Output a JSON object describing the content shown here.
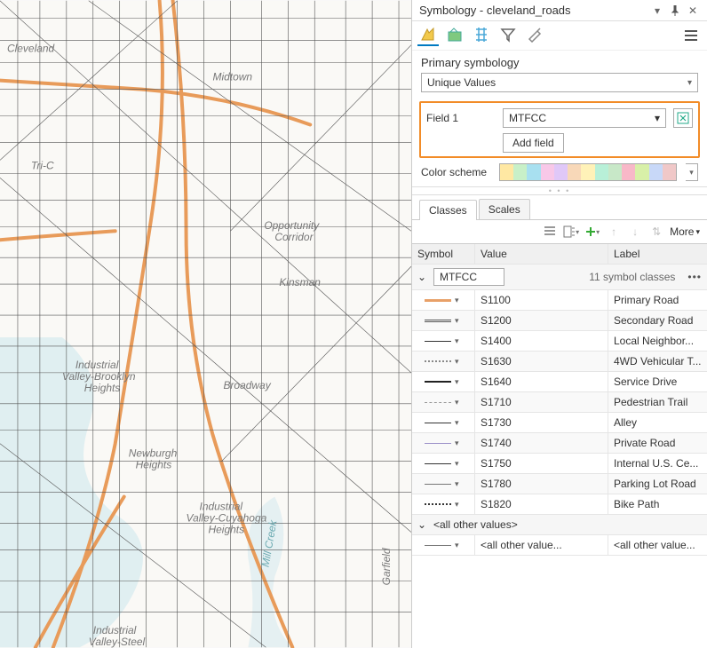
{
  "panel": {
    "title": "Symbology - cleveland_roads"
  },
  "primary_symbology": {
    "label": "Primary symbology",
    "value": "Unique Values"
  },
  "field1": {
    "label": "Field 1",
    "value": "MTFCC",
    "add_field": "Add field"
  },
  "color_scheme": {
    "label": "Color scheme",
    "colors": [
      "#ffe8a3",
      "#c8f0c8",
      "#a8e0f0",
      "#f8c8e8",
      "#e0c8f8",
      "#f8d8b8",
      "#fff2b8",
      "#b8f0d8",
      "#c8e8c8",
      "#f8b8c8",
      "#d8f0a8",
      "#c8d8f8",
      "#f0c8c8"
    ]
  },
  "tabs": {
    "classes": "Classes",
    "scales": "Scales"
  },
  "more": "More",
  "grid": {
    "headers": {
      "symbol": "Symbol",
      "value": "Value",
      "label": "Label"
    },
    "group": {
      "name": "MTFCC",
      "count": "11 symbol classes"
    },
    "rows": [
      {
        "value": "S1100",
        "label": "Primary Road",
        "color": "#e8a068",
        "style": "solid",
        "width": 3
      },
      {
        "value": "S1200",
        "label": "Secondary Road",
        "color": "#555",
        "style": "double",
        "width": 3
      },
      {
        "value": "S1400",
        "label": "Local Neighbor...",
        "color": "#333",
        "style": "solid",
        "width": 1
      },
      {
        "value": "S1630",
        "label": "4WD Vehicular T...",
        "color": "#888",
        "style": "dotted",
        "width": 2
      },
      {
        "value": "S1640",
        "label": "Service Drive",
        "color": "#222",
        "style": "solid",
        "width": 2
      },
      {
        "value": "S1710",
        "label": "Pedestrian Trail",
        "color": "#999",
        "style": "dashed",
        "width": 1
      },
      {
        "value": "S1730",
        "label": "Alley",
        "color": "#333",
        "style": "solid",
        "width": 1
      },
      {
        "value": "S1740",
        "label": "Private Road",
        "color": "#9a8fc8",
        "style": "solid",
        "width": 1
      },
      {
        "value": "S1750",
        "label": "Internal U.S. Ce...",
        "color": "#333",
        "style": "solid",
        "width": 1
      },
      {
        "value": "S1780",
        "label": "Parking Lot Road",
        "color": "#777",
        "style": "solid",
        "width": 1
      },
      {
        "value": "S1820",
        "label": "Bike Path",
        "color": "#333",
        "style": "dotted",
        "width": 2
      }
    ],
    "other": {
      "label": "<all other values>",
      "value": "<all other value...",
      "display": "<all other value..."
    }
  },
  "map_labels": [
    "Cleveland",
    "Tri-C",
    "Industrial Valley-Brooklyn Heights",
    "Newburgh Heights",
    "Industrial Valley-Cuyahoga Heights",
    "Industrial Valley-Steel",
    "Mill Creek",
    "Midtown",
    "Opportunity Corridor",
    "Kinsman",
    "Broadway",
    "Garfield"
  ]
}
